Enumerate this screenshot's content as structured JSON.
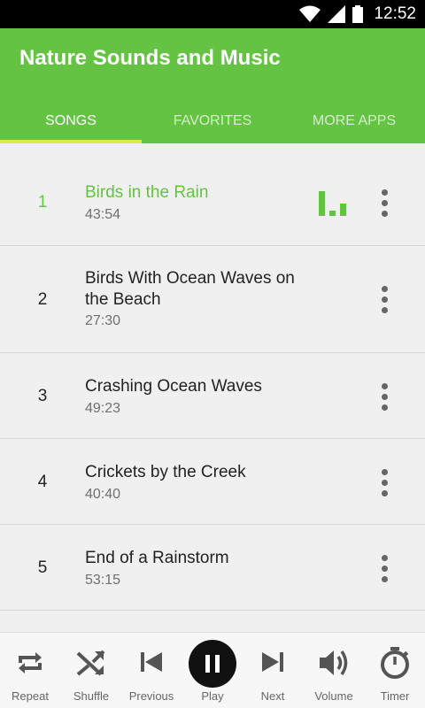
{
  "status_bar": {
    "time": "12:52"
  },
  "app": {
    "title": "Nature Sounds and Music"
  },
  "tabs": [
    {
      "label": "SONGS",
      "active": true
    },
    {
      "label": "FAVORITES",
      "active": false
    },
    {
      "label": "MORE APPS",
      "active": false
    }
  ],
  "songs": [
    {
      "number": "1",
      "title": "Birds in the Rain",
      "duration": "43:54",
      "playing": true
    },
    {
      "number": "2",
      "title": "Birds With Ocean Waves on the Beach",
      "duration": "27:30",
      "playing": false
    },
    {
      "number": "3",
      "title": "Crashing Ocean Waves",
      "duration": "49:23",
      "playing": false
    },
    {
      "number": "4",
      "title": "Crickets by the Creek",
      "duration": "40:40",
      "playing": false
    },
    {
      "number": "5",
      "title": "End of a Rainstorm",
      "duration": "53:15",
      "playing": false
    }
  ],
  "controls": {
    "repeat": "Repeat",
    "shuffle": "Shuffle",
    "previous": "Previous",
    "play": "Play",
    "next": "Next",
    "volume": "Volume",
    "timer": "Timer"
  },
  "colors": {
    "accent": "#64c342",
    "tab_indicator": "#d9ef3a"
  }
}
